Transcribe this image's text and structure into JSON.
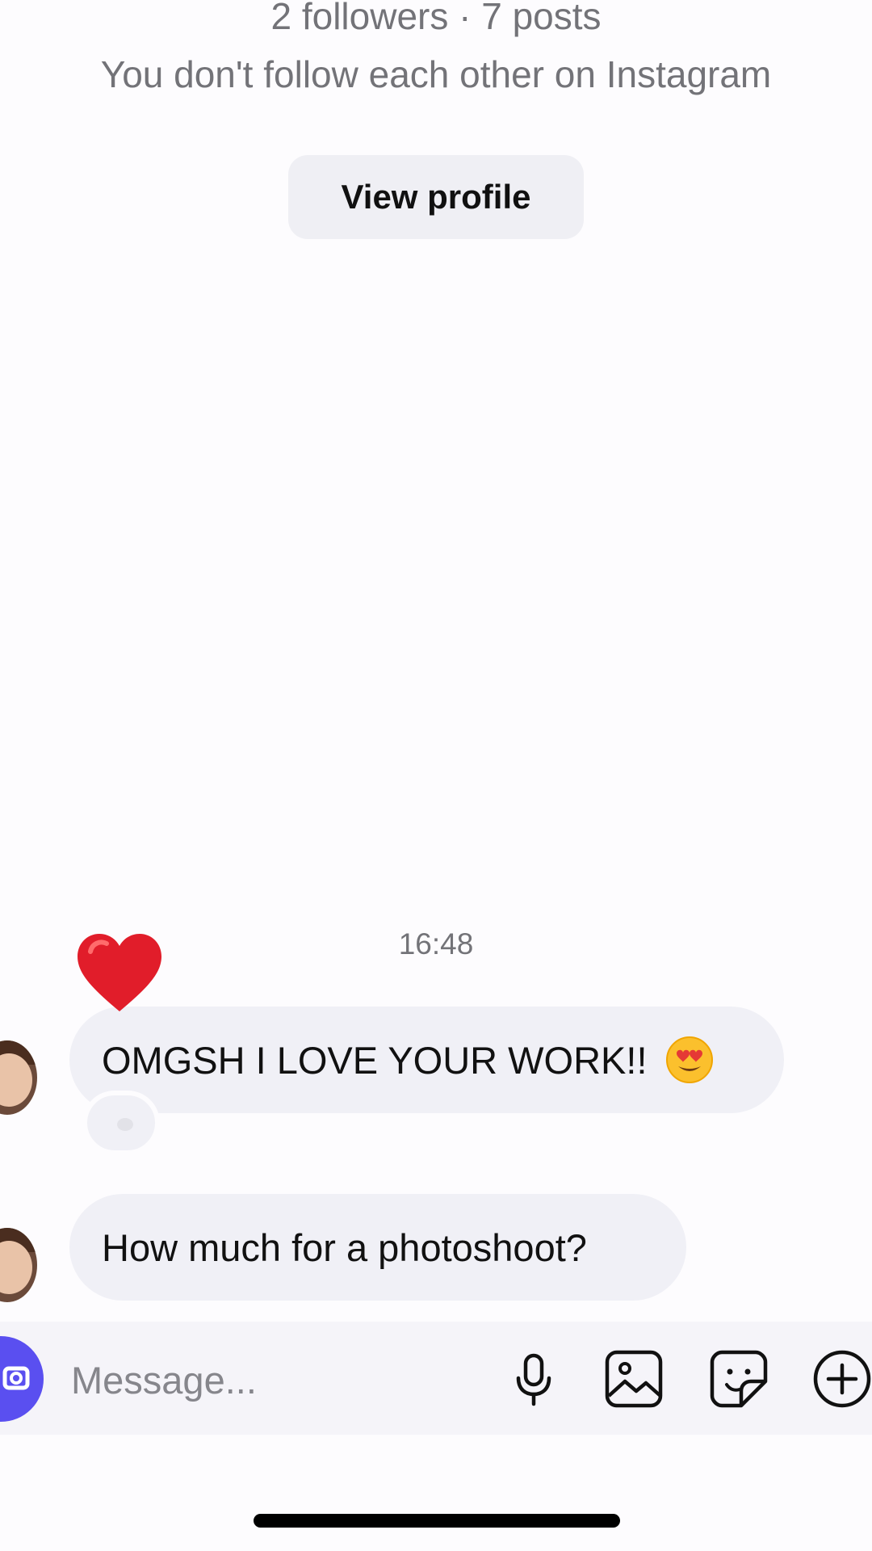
{
  "profile": {
    "stats": "2 followers · 7 posts",
    "follow_status": "You don't follow each other on Instagram",
    "view_profile_label": "View profile"
  },
  "chat": {
    "timestamp": "16:48",
    "messages": [
      {
        "text": "OMGSH I LOVE YOUR WORK!!",
        "emoji": "smiling-face-with-heart-eyes",
        "reaction": "red-heart"
      },
      {
        "text": "How much for a photoshoot?"
      }
    ]
  },
  "composer": {
    "placeholder": "Message...",
    "icons": [
      "camera-icon",
      "microphone-icon",
      "gallery-icon",
      "sticker-icon",
      "plus-circle-icon"
    ],
    "accent_color": "#5a4ff0"
  }
}
